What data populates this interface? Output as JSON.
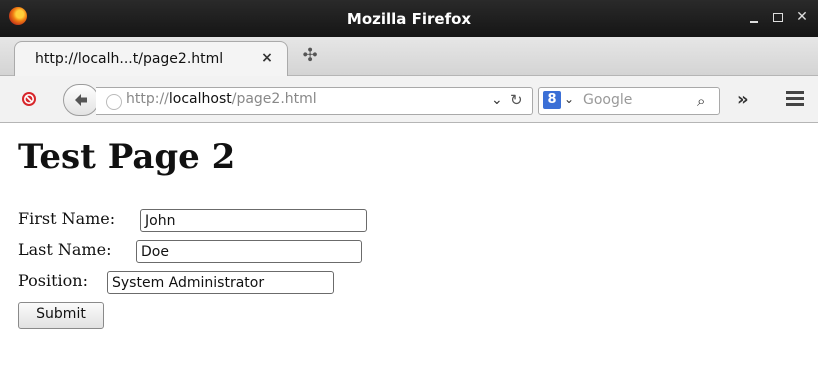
{
  "window": {
    "title": "Mozilla Firefox"
  },
  "tab": {
    "title": "http://localh...t/page2.html",
    "close_glyph": "×"
  },
  "navbar": {
    "url_scheme": "http://",
    "url_host": "localhost",
    "url_path": "/page2.html",
    "search_placeholder": "Google",
    "search_engine_glyph": "8",
    "overflow_glyph": "»"
  },
  "page": {
    "title": "Test Page 2",
    "first_name_label": "First Name:",
    "first_name_value": "John",
    "last_name_label": "Last Name:",
    "last_name_value": "Doe",
    "position_label": "Position:",
    "position_value": "System Administrator",
    "submit_label": "Submit"
  },
  "colors": {
    "titlebar": "#1f1f1f",
    "tabstrip": "#dcdcdc",
    "navbar": "#f2f2f2"
  },
  "icons": [
    "firefox-logo-icon",
    "minimize-icon",
    "maximize-icon",
    "close-icon",
    "new-tab-icon",
    "stop-icon",
    "back-arrow-icon",
    "globe-icon",
    "dropdown-arrow-icon",
    "reload-icon",
    "google-icon",
    "binoculars-icon",
    "overflow-icon",
    "hamburger-menu-icon"
  ]
}
